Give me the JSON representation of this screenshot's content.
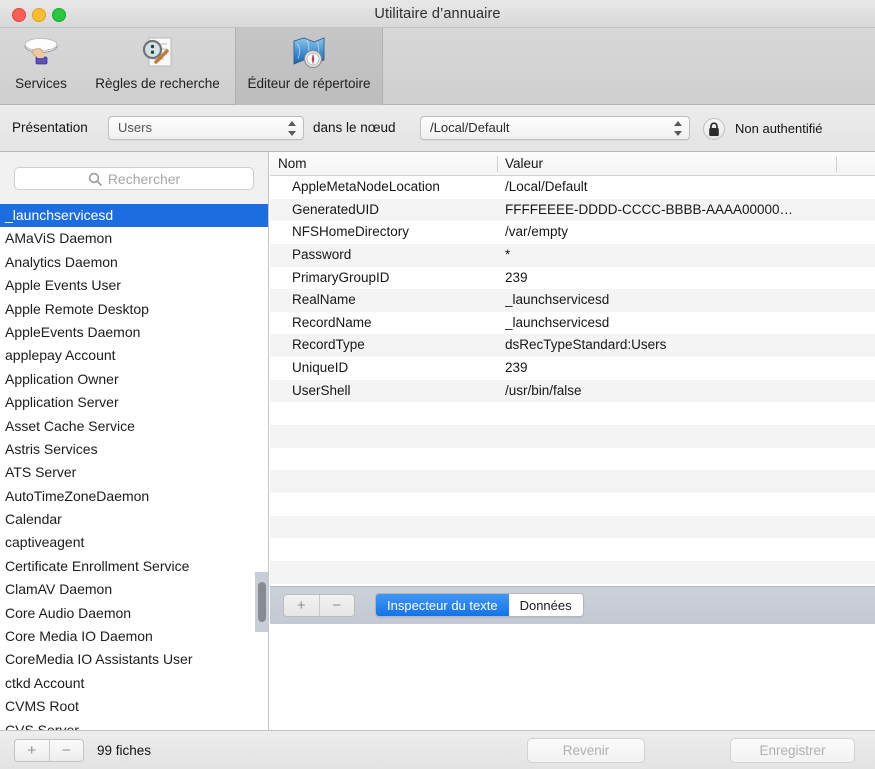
{
  "window": {
    "title": "Utilitaire d’annuaire",
    "traffic_lights": [
      "close",
      "minimize",
      "maximize"
    ]
  },
  "toolbar": {
    "items": [
      {
        "label": "Services",
        "icon": "services-icon",
        "selected": false
      },
      {
        "label": "Règles de recherche",
        "icon": "search-rules-icon",
        "selected": false
      },
      {
        "label": "Éditeur de répertoire",
        "icon": "directory-editor-icon",
        "selected": true
      }
    ]
  },
  "optionbar": {
    "presentation_label": "Présentation",
    "presentation_value": "Users",
    "node_label": "dans le nœud",
    "node_value": "/Local/Default",
    "auth_status": "Non authentifié",
    "lock_icon": "lock-closed-icon"
  },
  "sidebar": {
    "search_placeholder": "Rechercher",
    "search_value": "",
    "search_icon": "search-icon",
    "selected_index": 0,
    "records": [
      "_launchservicesd",
      "AMaViS Daemon",
      "Analytics Daemon",
      "Apple Events User",
      "Apple Remote Desktop",
      "AppleEvents Daemon",
      "applepay Account",
      "Application Owner",
      "Application Server",
      "Asset Cache Service",
      "Astris Services",
      "ATS Server",
      "AutoTimeZoneDaemon",
      "Calendar",
      "captiveagent",
      "Certificate Enrollment Service",
      "ClamAV Daemon",
      "Core Audio Daemon",
      "Core Media IO Daemon",
      "CoreMedia IO Assistants User",
      "ctkd Account",
      "CVMS Root",
      "CVS Server"
    ]
  },
  "detail": {
    "columns": [
      "Nom",
      "Valeur"
    ],
    "rows": [
      {
        "name": "AppleMetaNodeLocation",
        "value": "/Local/Default"
      },
      {
        "name": "GeneratedUID",
        "value": "FFFFEEEE-DDDD-CCCC-BBBB-AAAA00000…"
      },
      {
        "name": "NFSHomeDirectory",
        "value": "/var/empty"
      },
      {
        "name": "Password",
        "value": "*"
      },
      {
        "name": "PrimaryGroupID",
        "value": "239"
      },
      {
        "name": "RealName",
        "value": "_launchservicesd"
      },
      {
        "name": "RecordName",
        "value": "_launchservicesd"
      },
      {
        "name": "RecordType",
        "value": "dsRecTypeStandard:Users"
      },
      {
        "name": "UniqueID",
        "value": "239"
      },
      {
        "name": "UserShell",
        "value": "/usr/bin/false"
      }
    ],
    "empty_row_count": 8
  },
  "inspector": {
    "add_label": "+",
    "remove_label": "−",
    "tabs": [
      {
        "label": "Inspecteur du texte",
        "active": true
      },
      {
        "label": "Données",
        "active": false
      }
    ],
    "active_tab_color": "#1673e8"
  },
  "footer": {
    "add_label": "+",
    "remove_label": "−",
    "record_count": "99 fiches",
    "revert_label": "Revenir",
    "save_label": "Enregistrer"
  }
}
